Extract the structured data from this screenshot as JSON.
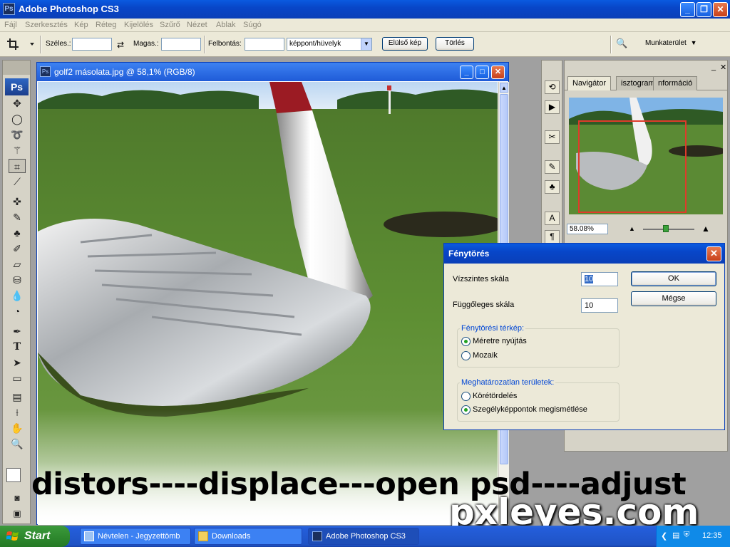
{
  "app": {
    "title": "Adobe Photoshop CS3",
    "logo": "Ps"
  },
  "menu": [
    "Fájl",
    "Szerkesztés",
    "Kép",
    "Réteg",
    "Kijelölés",
    "Szűrő",
    "Nézet",
    "Ablak",
    "Súgó"
  ],
  "options": {
    "width_label": "Széles.:",
    "width_value": "",
    "height_label": "Magas.:",
    "height_value": "",
    "resolution_label": "Felbontás:",
    "resolution_value": "",
    "unit_value": "képpont/hüvelyk",
    "front_image_button": "Elülső kép",
    "clear_button": "Törlés",
    "workspace_button": "Munkaterület"
  },
  "toolbox": {
    "badge": "Ps"
  },
  "document": {
    "title": "golf2 másolata.jpg @ 58,1% (RGB/8)",
    "logo": "Ps"
  },
  "panel": {
    "tabs": [
      "Navigátor",
      "isztogram",
      "nformáció"
    ],
    "zoom_value": "58.08%"
  },
  "dialog": {
    "title": "Fénytörés",
    "horizontal_scale_label": "Vízszintes skála",
    "horizontal_scale_value": "10",
    "vertical_scale_label": "Függőleges skála",
    "vertical_scale_value": "10",
    "ok_button": "OK",
    "cancel_button": "Mégse",
    "map_group_label": "Fénytörési térkép:",
    "map_options": [
      "Méretre nyújtás",
      "Mozaik"
    ],
    "map_selected": 0,
    "undefined_group_label": "Meghatározatlan területek:",
    "undefined_options": [
      "Körétördelés",
      "Szegélyképpontok megismétlése"
    ],
    "undefined_selected": 1
  },
  "caption": "distors----displace---open psd----adjust",
  "watermark": "pxleyes.com",
  "taskbar": {
    "start_label": "Start",
    "items": [
      "Névtelen - Jegyzettömb",
      "Downloads",
      "Adobe Photoshop CS3"
    ],
    "clock": "12:35"
  },
  "colors": {
    "title_blue": "#0a5ae0",
    "start_green": "#2f8a2f",
    "dialog_bg": "#ece9d8"
  }
}
